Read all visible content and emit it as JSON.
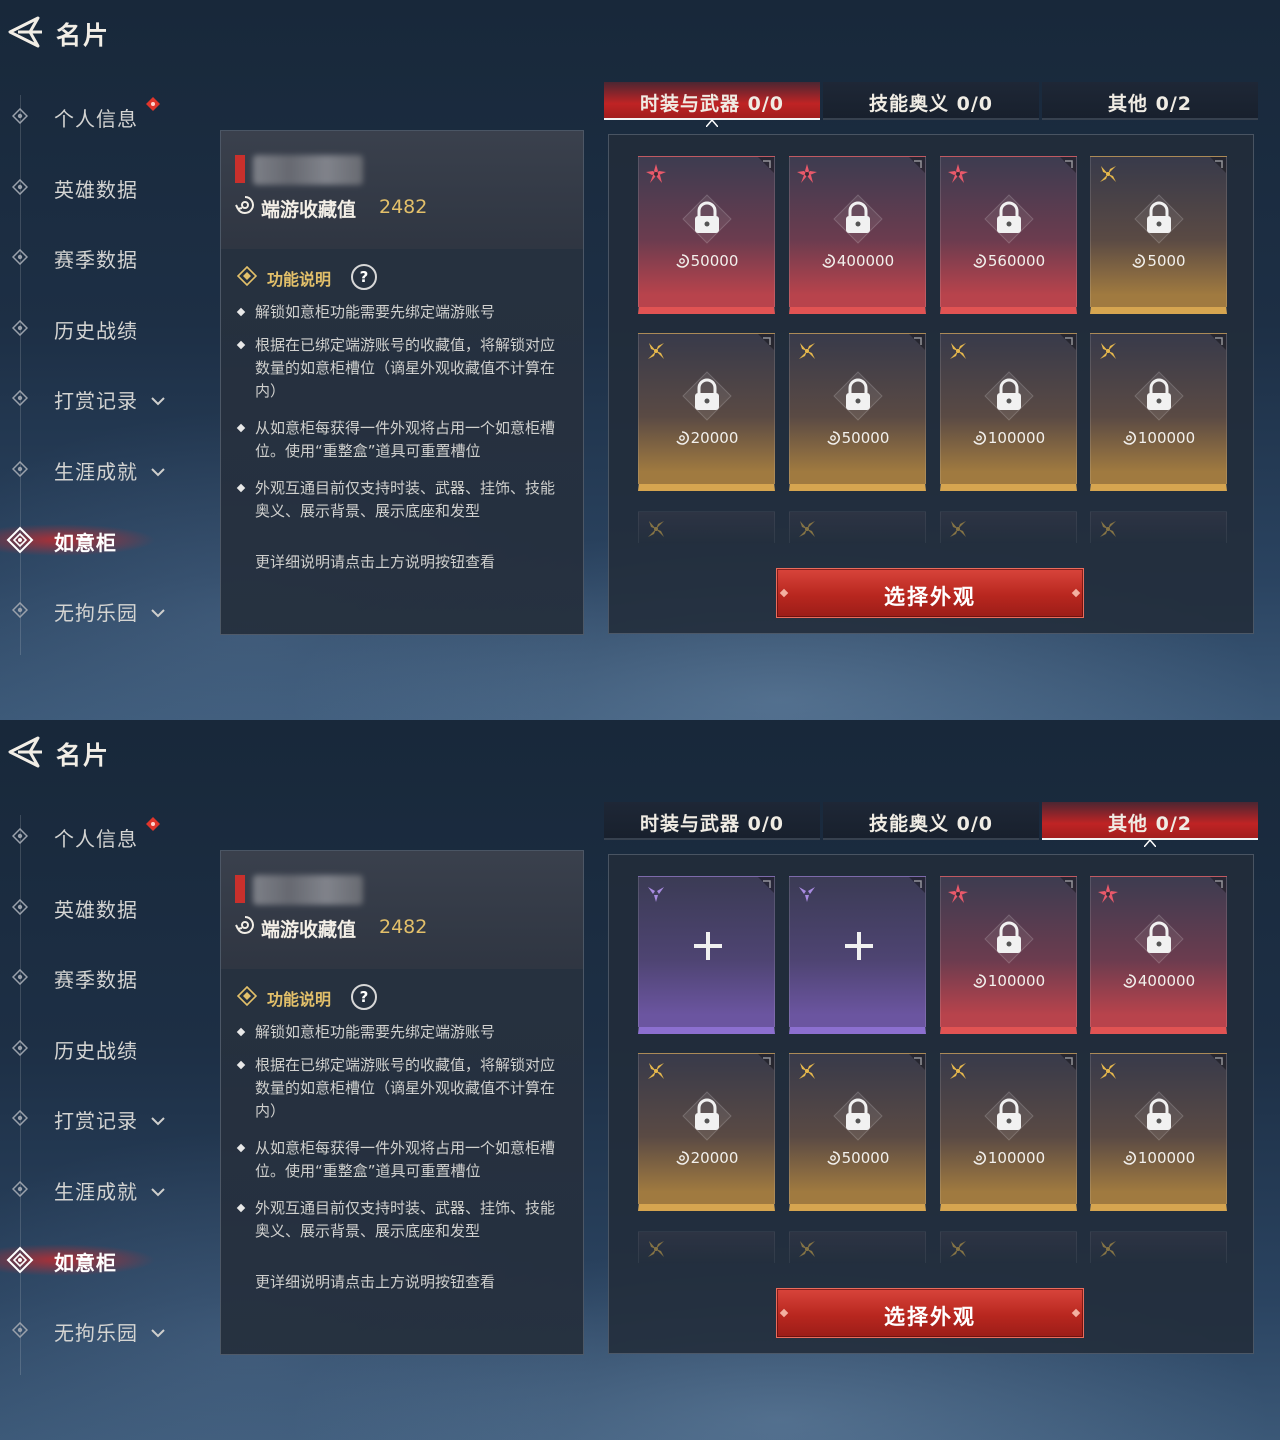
{
  "colors": {
    "accent_red": "#c9302c",
    "gold": "#e3c06a",
    "purple": "#8c6fd0"
  },
  "screens": [
    {
      "title": "名片",
      "nav": [
        {
          "label": "个人信息",
          "badge": true,
          "chevron": false,
          "active": false
        },
        {
          "label": "英雄数据",
          "badge": false,
          "chevron": false,
          "active": false
        },
        {
          "label": "赛季数据",
          "badge": false,
          "chevron": false,
          "active": false
        },
        {
          "label": "历史战绩",
          "badge": false,
          "chevron": false,
          "active": false
        },
        {
          "label": "打赏记录",
          "badge": false,
          "chevron": true,
          "active": false
        },
        {
          "label": "生涯成就",
          "badge": false,
          "chevron": true,
          "active": false
        },
        {
          "label": "如意柜",
          "badge": false,
          "chevron": false,
          "active": true
        },
        {
          "label": "无拘乐园",
          "badge": false,
          "chevron": true,
          "active": false
        }
      ],
      "info": {
        "collection_label": "端游收藏值",
        "collection_value": "2482",
        "func_title": "功能说明",
        "help": "?",
        "bullets": [
          "解锁如意柜功能需要先绑定端游账号",
          "根据在已绑定端游账号的收藏值，将解锁对应数量的如意柜槽位（谪星外观收藏值不计算在内）",
          "从如意柜每获得一件外观将占用一个如意柜槽位。使用“重整盒”道具可重置槽位",
          "外观互通目前仅支持时装、武器、挂饰、技能奥义、展示背景、展示底座和发型"
        ],
        "more": "更详细说明请点击上方说明按钮查看"
      },
      "tabs": [
        {
          "name": "时装与武器",
          "count": "0/0",
          "active": true
        },
        {
          "name": "技能奥义",
          "count": "0/0",
          "active": false
        },
        {
          "name": "其他",
          "count": "0/2",
          "active": false
        }
      ],
      "cards": [
        {
          "rarity": "red",
          "state": "locked",
          "price": "50000"
        },
        {
          "rarity": "red",
          "state": "locked",
          "price": "400000"
        },
        {
          "rarity": "red",
          "state": "locked",
          "price": "560000"
        },
        {
          "rarity": "gold",
          "state": "locked",
          "price": "5000"
        },
        {
          "rarity": "gold",
          "state": "locked",
          "price": "20000"
        },
        {
          "rarity": "gold",
          "state": "locked",
          "price": "50000"
        },
        {
          "rarity": "gold",
          "state": "locked",
          "price": "100000"
        },
        {
          "rarity": "gold",
          "state": "locked",
          "price": "100000"
        }
      ],
      "select_button": "选择外观"
    },
    {
      "title": "名片",
      "nav": [
        {
          "label": "个人信息",
          "badge": true,
          "chevron": false,
          "active": false
        },
        {
          "label": "英雄数据",
          "badge": false,
          "chevron": false,
          "active": false
        },
        {
          "label": "赛季数据",
          "badge": false,
          "chevron": false,
          "active": false
        },
        {
          "label": "历史战绩",
          "badge": false,
          "chevron": false,
          "active": false
        },
        {
          "label": "打赏记录",
          "badge": false,
          "chevron": true,
          "active": false
        },
        {
          "label": "生涯成就",
          "badge": false,
          "chevron": true,
          "active": false
        },
        {
          "label": "如意柜",
          "badge": false,
          "chevron": false,
          "active": true
        },
        {
          "label": "无拘乐园",
          "badge": false,
          "chevron": true,
          "active": false
        }
      ],
      "info": {
        "collection_label": "端游收藏值",
        "collection_value": "2482",
        "func_title": "功能说明",
        "help": "?",
        "bullets": [
          "解锁如意柜功能需要先绑定端游账号",
          "根据在已绑定端游账号的收藏值，将解锁对应数量的如意柜槽位（谪星外观收藏值不计算在内）",
          "从如意柜每获得一件外观将占用一个如意柜槽位。使用“重整盒”道具可重置槽位",
          "外观互通目前仅支持时装、武器、挂饰、技能奥义、展示背景、展示底座和发型"
        ],
        "more": "更详细说明请点击上方说明按钮查看"
      },
      "tabs": [
        {
          "name": "时装与武器",
          "count": "0/0",
          "active": false
        },
        {
          "name": "技能奥义",
          "count": "0/0",
          "active": false
        },
        {
          "name": "其他",
          "count": "0/2",
          "active": true
        }
      ],
      "cards": [
        {
          "rarity": "purple",
          "state": "empty",
          "price": ""
        },
        {
          "rarity": "purple",
          "state": "empty",
          "price": ""
        },
        {
          "rarity": "red",
          "state": "locked",
          "price": "100000"
        },
        {
          "rarity": "red",
          "state": "locked",
          "price": "400000"
        },
        {
          "rarity": "gold",
          "state": "locked",
          "price": "20000"
        },
        {
          "rarity": "gold",
          "state": "locked",
          "price": "50000"
        },
        {
          "rarity": "gold",
          "state": "locked",
          "price": "100000"
        },
        {
          "rarity": "gold",
          "state": "locked",
          "price": "100000"
        }
      ],
      "select_button": "选择外观"
    }
  ]
}
